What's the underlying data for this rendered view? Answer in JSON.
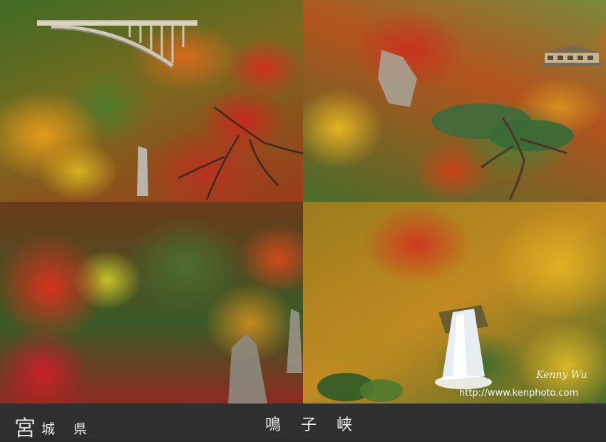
{
  "photo": {
    "signature": "Kenny Wu",
    "url": "http://www.kenphoto.com"
  },
  "caption": {
    "prefecture_first": "宮",
    "prefecture_rest": "城 県",
    "place": "鳴子峡"
  }
}
